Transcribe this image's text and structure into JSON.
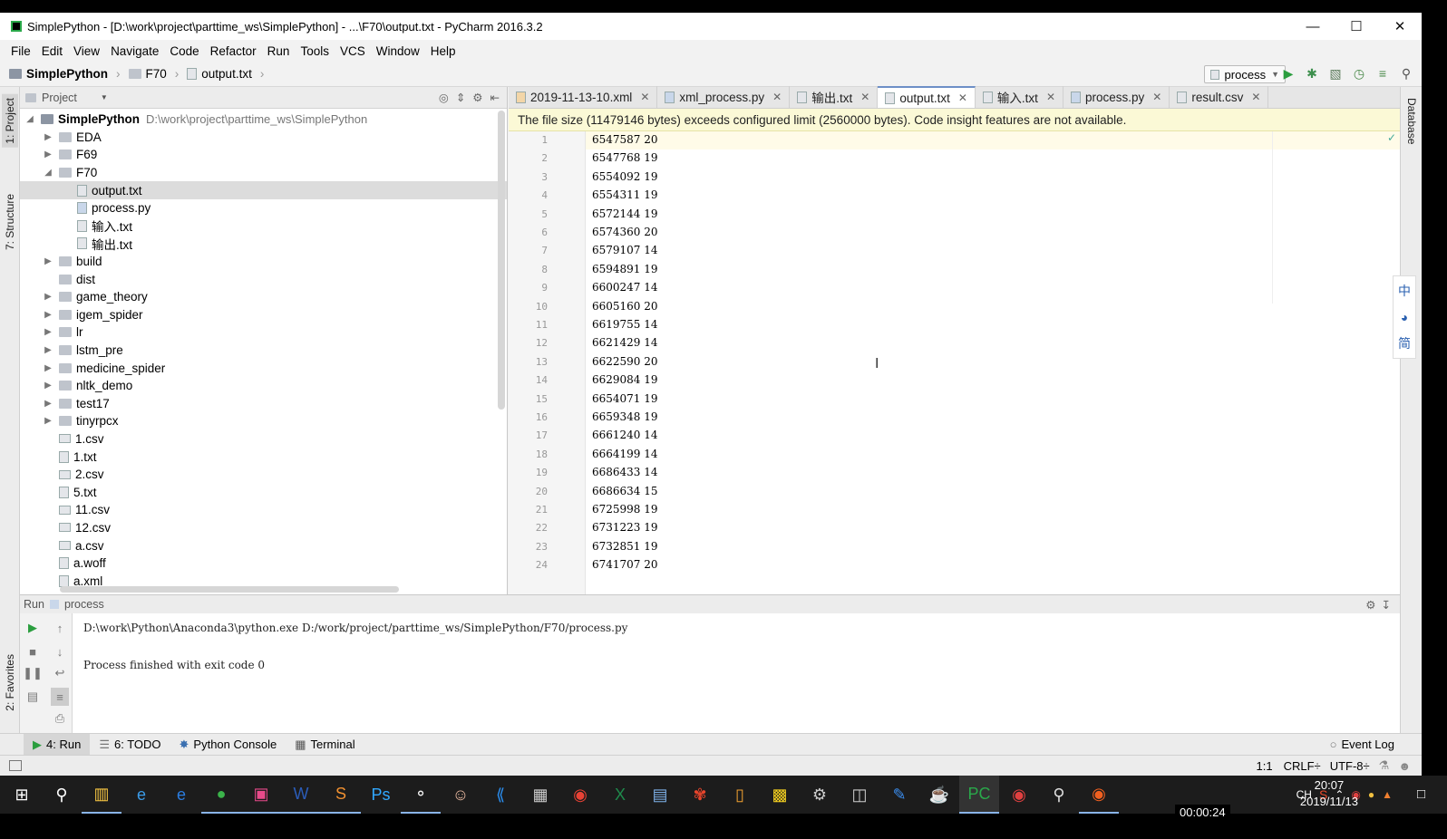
{
  "window": {
    "title": "SimplePython - [D:\\work\\project\\parttime_ws\\SimplePython] - ...\\F70\\output.txt - PyCharm 2016.3.2",
    "minimize_icon": "minimize-icon",
    "maximize_icon": "maximize-icon",
    "close_icon": "close-icon"
  },
  "menu": [
    "File",
    "Edit",
    "View",
    "Navigate",
    "Code",
    "Refactor",
    "Run",
    "Tools",
    "VCS",
    "Window",
    "Help"
  ],
  "breadcrumb": {
    "project": "SimplePython",
    "folder": "F70",
    "file": "output.txt"
  },
  "toolbar": {
    "run_config": "process"
  },
  "left_strip": {
    "project_tab": "1: Project",
    "structure_tab": "7: Structure",
    "favorites_tab": "2: Favorites"
  },
  "right_strip": {
    "database_tab": "Database"
  },
  "project_panel": {
    "header": "Project",
    "root_name": "SimplePython",
    "root_path": "D:\\work\\project\\parttime_ws\\SimplePython",
    "items": [
      {
        "name": "EDA",
        "type": "folder",
        "level": 1,
        "expanded": false
      },
      {
        "name": "F69",
        "type": "folder",
        "level": 1,
        "expanded": false
      },
      {
        "name": "F70",
        "type": "folder",
        "level": 1,
        "expanded": true
      },
      {
        "name": "output.txt",
        "type": "file",
        "level": 2,
        "selected": true
      },
      {
        "name": "process.py",
        "type": "py",
        "level": 2
      },
      {
        "name": "输入.txt",
        "type": "file",
        "level": 2
      },
      {
        "name": "输出.txt",
        "type": "file",
        "level": 2
      },
      {
        "name": "build",
        "type": "folder",
        "level": 1,
        "expanded": false
      },
      {
        "name": "dist",
        "type": "folder",
        "level": 1,
        "noarrow": true
      },
      {
        "name": "game_theory",
        "type": "folder",
        "level": 1,
        "expanded": false
      },
      {
        "name": "igem_spider",
        "type": "folder",
        "level": 1,
        "expanded": false
      },
      {
        "name": "lr",
        "type": "folder",
        "level": 1,
        "expanded": false
      },
      {
        "name": "lstm_pre",
        "type": "folder",
        "level": 1,
        "expanded": false
      },
      {
        "name": "medicine_spider",
        "type": "folder",
        "level": 1,
        "expanded": false
      },
      {
        "name": "nltk_demo",
        "type": "folder",
        "level": 1,
        "expanded": false
      },
      {
        "name": "test17",
        "type": "folder",
        "level": 1,
        "expanded": false
      },
      {
        "name": "tinyrpcx",
        "type": "folder",
        "level": 1,
        "expanded": false
      },
      {
        "name": "1.csv",
        "type": "csv",
        "level": 1
      },
      {
        "name": "1.txt",
        "type": "file",
        "level": 1
      },
      {
        "name": "2.csv",
        "type": "csv",
        "level": 1
      },
      {
        "name": "5.txt",
        "type": "file",
        "level": 1
      },
      {
        "name": "11.csv",
        "type": "csv",
        "level": 1
      },
      {
        "name": "12.csv",
        "type": "csv",
        "level": 1
      },
      {
        "name": "a.csv",
        "type": "csv",
        "level": 1
      },
      {
        "name": "a.woff",
        "type": "file",
        "level": 1
      },
      {
        "name": "a.xml",
        "type": "file",
        "level": 1
      }
    ]
  },
  "editor_tabs": [
    {
      "label": "2019-11-13-10.xml",
      "active": false
    },
    {
      "label": "xml_process.py",
      "active": false
    },
    {
      "label": "输出.txt",
      "active": false
    },
    {
      "label": "output.txt",
      "active": true
    },
    {
      "label": "输入.txt",
      "active": false
    },
    {
      "label": "process.py",
      "active": false
    },
    {
      "label": "result.csv",
      "active": false
    }
  ],
  "warning": "The file size (11479146 bytes) exceeds configured limit (2560000 bytes). Code insight features are not available.",
  "code_lines": [
    "6547587 20",
    "6547768 19",
    "6554092 19",
    "6554311 19",
    "6572144 19",
    "6574360 20",
    "6579107 14",
    "6594891 19",
    "6600247 14",
    "6605160 20",
    "6619755 14",
    "6621429 14",
    "6622590 20",
    "6629084 19",
    "6654071 19",
    "6659348 19",
    "6661240 14",
    "6664199 14",
    "6686433 14",
    "6686634 15",
    "6725998 19",
    "6731223 19",
    "6732851 19",
    "6741707 20"
  ],
  "run_panel": {
    "label": "Run",
    "config": "process",
    "command": "D:\\work\\Python\\Anaconda3\\python.exe D:/work/project/parttime_ws/SimplePython/F70/process.py",
    "result": "Process finished with exit code 0"
  },
  "bottom_tabs": [
    {
      "label": "4: Run",
      "active": true
    },
    {
      "label": "6: TODO",
      "active": false
    },
    {
      "label": "Python Console",
      "active": false
    },
    {
      "label": "Terminal",
      "active": false
    }
  ],
  "event_log": "Event Log",
  "status": {
    "position": "1:1",
    "line_sep": "CRLF÷",
    "encoding": "UTF-8÷"
  },
  "ime_icons": [
    "中",
    "◕",
    "简"
  ],
  "taskbar": {
    "tray_lang": "CH",
    "time": "20:07",
    "date": "2019/11/13",
    "timer": "00:00:24"
  }
}
